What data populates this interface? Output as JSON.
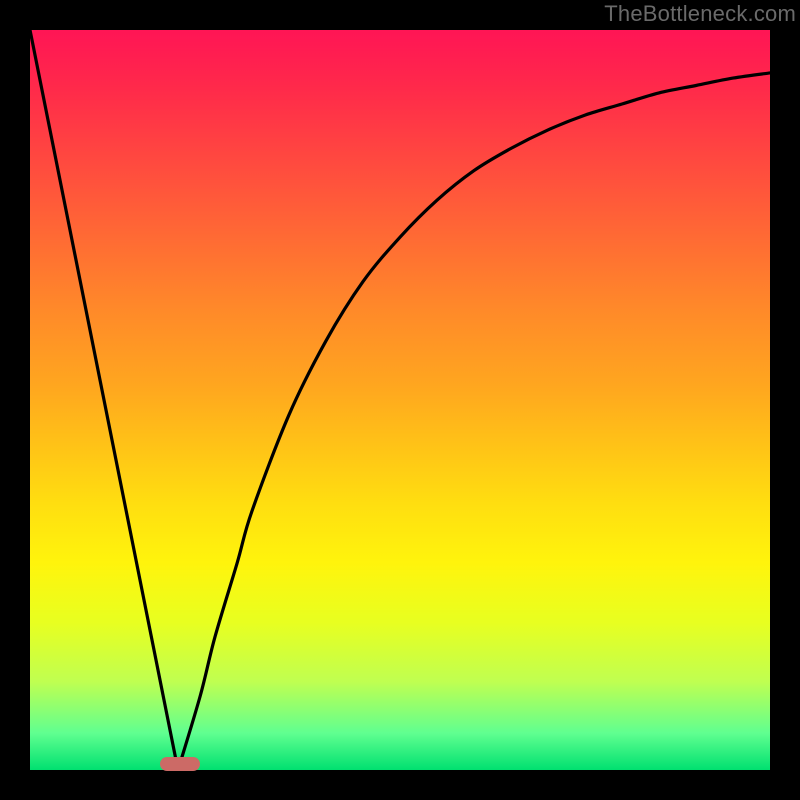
{
  "watermark": "TheBottleneck.com",
  "chart_data": {
    "type": "line",
    "title": "",
    "xlabel": "",
    "ylabel": "",
    "xlim": [
      0,
      100
    ],
    "ylim": [
      0,
      100
    ],
    "grid": false,
    "series": [
      {
        "name": "left-line",
        "x": [
          0,
          20
        ],
        "y": [
          100,
          0
        ]
      },
      {
        "name": "right-curve",
        "x": [
          20,
          23,
          25,
          28,
          30,
          35,
          40,
          45,
          50,
          55,
          60,
          65,
          70,
          75,
          80,
          85,
          90,
          95,
          100
        ],
        "y": [
          0,
          10,
          18,
          28,
          35,
          48,
          58,
          66,
          72,
          77,
          81,
          84,
          86.5,
          88.5,
          90,
          91.5,
          92.5,
          93.5,
          94.2
        ]
      }
    ],
    "marker": {
      "x_center": 20.3,
      "y_center": 0.8,
      "width_pct": 5.4,
      "height_pct": 2.0,
      "color": "#cc6a66",
      "shape": "rounded-rect"
    }
  },
  "colors": {
    "background": "#000000",
    "curve": "#000000",
    "marker": "#cc6a66",
    "watermark": "#6a6a6a"
  }
}
